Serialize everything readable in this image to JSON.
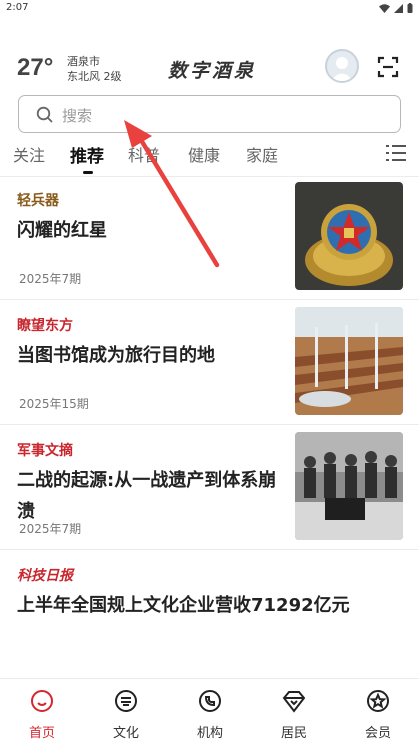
{
  "status_bar": {
    "time": "2:07"
  },
  "header": {
    "temperature": "27°",
    "city": "酒泉市",
    "wind": "东北风  2级",
    "logo": "数字酒泉"
  },
  "search": {
    "placeholder": "搜索"
  },
  "tabs": [
    {
      "label": "关注",
      "active": false
    },
    {
      "label": "推荐",
      "active": true
    },
    {
      "label": "科普",
      "active": false
    },
    {
      "label": "健康",
      "active": false
    },
    {
      "label": "家庭",
      "active": false
    }
  ],
  "articles": [
    {
      "source": "轻兵器",
      "source_color": "#8a5a1a",
      "title": "闪耀的红星",
      "issue": "2025年7期",
      "thumb": "red-star-badge-photo"
    },
    {
      "source": "瞭望东方",
      "source_color": "#c8252c",
      "title": "当图书馆成为旅行目的地",
      "issue": "2025年15期",
      "thumb": "library-interior-photo"
    },
    {
      "source": "军事文摘",
      "source_color": "#c8252c",
      "title": "二战的起源:从一战遗产到体系崩溃",
      "issue": "2025年7期",
      "thumb": "historical-signing-photo"
    },
    {
      "source": "科技日报",
      "source_color": "#c8252c",
      "title": "上半年全国规上文化企业营收71292亿元",
      "issue": "",
      "thumb": ""
    }
  ],
  "bottom_nav": [
    {
      "label": "首页",
      "icon": "home-icon",
      "active": true
    },
    {
      "label": "文化",
      "icon": "culture-icon",
      "active": false
    },
    {
      "label": "机构",
      "icon": "institution-icon",
      "active": false
    },
    {
      "label": "居民",
      "icon": "resident-icon",
      "active": false
    },
    {
      "label": "会员",
      "icon": "member-icon",
      "active": false
    }
  ],
  "colors": {
    "accent": "#d6262e",
    "arrow": "#e8413e"
  }
}
